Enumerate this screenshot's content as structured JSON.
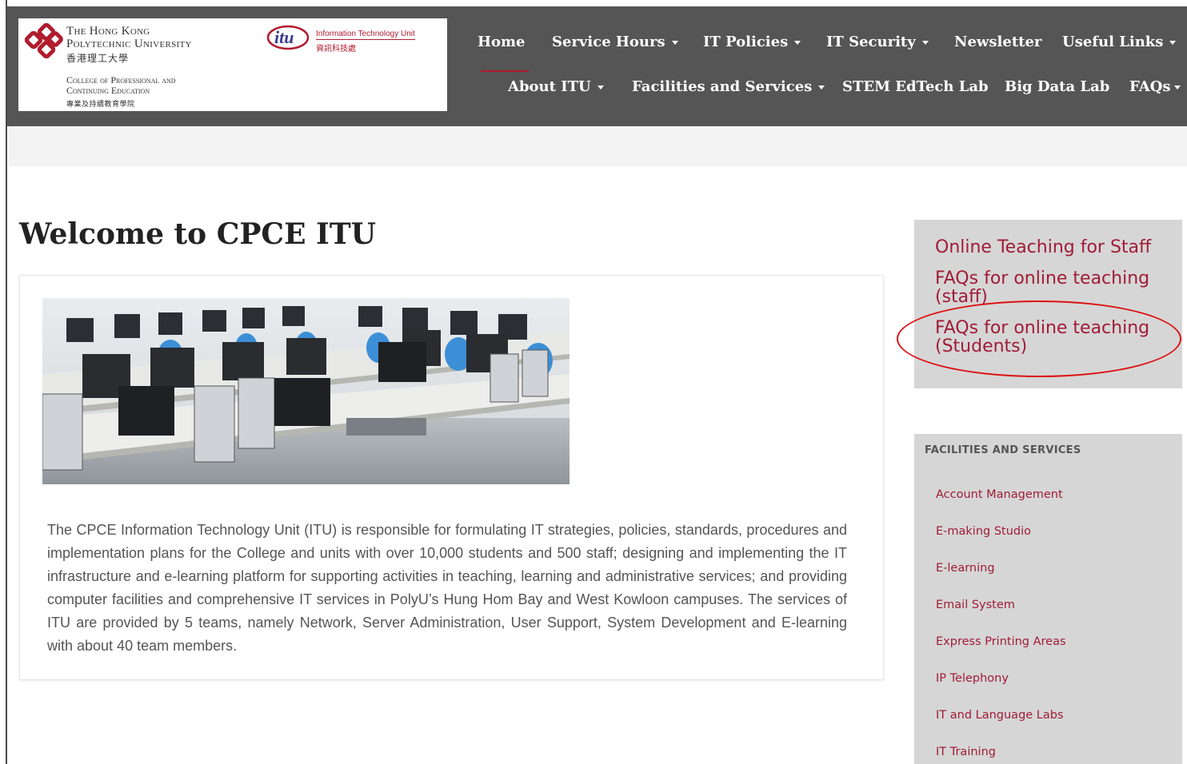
{
  "logo": {
    "polyu_line1": "The Hong Kong",
    "polyu_line2": "Polytechnic University",
    "polyu_zh": "香港理工大學",
    "itu_mark": "itu",
    "itu_label": "Information Technology Unit",
    "itu_zh": "資訊科技處",
    "cpce_line1": "College of Professional and",
    "cpce_line2": "Continuing Education",
    "cpce_zh": "專業及持續教育學院"
  },
  "nav": {
    "row1": [
      {
        "label": "Home",
        "dropdown": false,
        "active": true
      },
      {
        "label": "Service Hours",
        "dropdown": true
      },
      {
        "label": "IT Policies",
        "dropdown": true
      },
      {
        "label": "IT Security",
        "dropdown": true
      },
      {
        "label": "Newsletter",
        "dropdown": false
      },
      {
        "label": "Useful Links",
        "dropdown": true
      }
    ],
    "row2": [
      {
        "label": "About ITU",
        "dropdown": true
      },
      {
        "label": "Facilities and Services",
        "dropdown": true
      },
      {
        "label": "STEM EdTech Lab",
        "dropdown": false
      },
      {
        "label": "Big Data Lab",
        "dropdown": false
      },
      {
        "label": "FAQs",
        "dropdown": true
      }
    ]
  },
  "main": {
    "title": "Welcome to CPCE ITU",
    "intro": "The CPCE Information Technology Unit (ITU) is responsible for formulating IT strategies, policies, standards, procedures and implementation plans for the College and units with over 10,000 students and 500 staff; designing and implementing the IT infrastructure and e-learning platform for supporting activities in teaching, learning and administrative services; and providing computer facilities and comprehensive IT services in PolyU’s Hung Hom Bay and West Kowloon campuses. The services of ITU are provided by 5 teams, namely Network, Server Administration, User Support, System Development and E-learning with about 40 team members."
  },
  "sidebar": {
    "quick_links": [
      "Online Teaching for Staff",
      "FAQs for online teaching (staff)",
      "FAQs for online teaching (Students)"
    ],
    "facilities_heading": "FACILITIES AND SERVICES",
    "facilities": [
      "Account Management",
      "E-making Studio",
      "E-learning",
      "Email System",
      "Express Printing Areas",
      "IP Telephony",
      "IT and Language Labs",
      "IT Training"
    ]
  },
  "colors": {
    "header_bg": "#555555",
    "accent": "#b01c2e",
    "link": "#a01c36",
    "sidebar_bg": "#d6d6d6",
    "highlight_oval": "#dd1111"
  }
}
